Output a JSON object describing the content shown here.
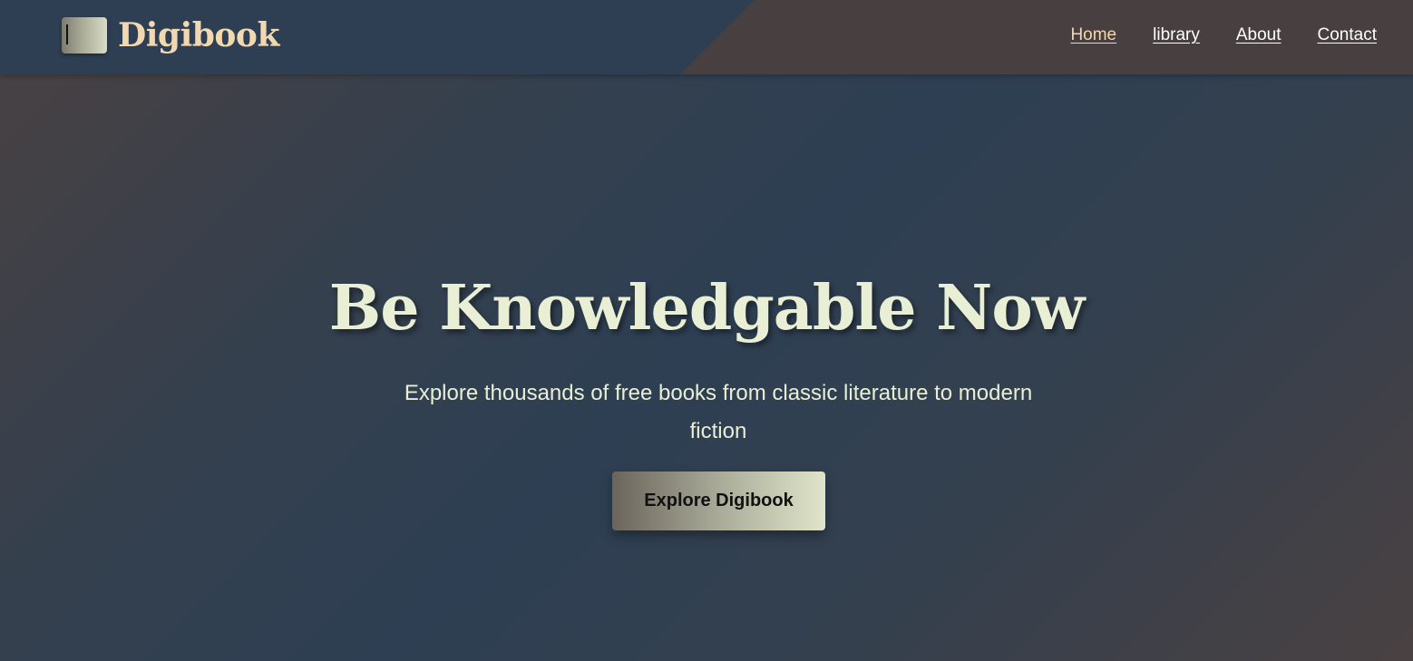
{
  "brand": {
    "name": "Digibook",
    "logo_icon": "book-icon"
  },
  "nav": {
    "items": [
      {
        "label": "Home",
        "active": true
      },
      {
        "label": "library",
        "active": false
      },
      {
        "label": "About",
        "active": false
      },
      {
        "label": "Contact",
        "active": false
      }
    ]
  },
  "hero": {
    "title": "Be Knowledgable Now",
    "subtitle": "Explore thousands of free books from classic literature to modern fiction",
    "cta_label": "Explore Digibook"
  },
  "colors": {
    "accent": "#f1d8b1",
    "header_dark": "#2e3f53",
    "header_brown": "#483f40",
    "hero_text": "#e8efd4"
  }
}
